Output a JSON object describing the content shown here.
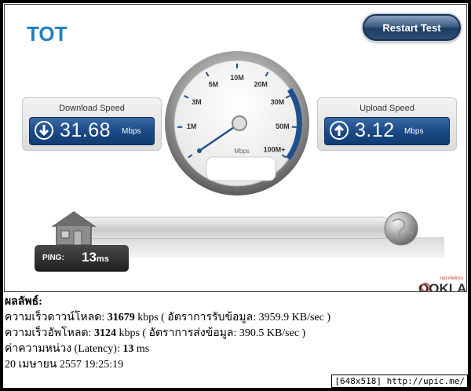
{
  "brand": {
    "logo_text": "TOT",
    "logo_color": "#1f7fc2"
  },
  "toolbar": {
    "restart_label": "Restart Test"
  },
  "download": {
    "title": "Download Speed",
    "value": "31.68",
    "unit": "Mbps"
  },
  "upload": {
    "title": "Upload Speed",
    "value": "3.12",
    "unit": "Mbps"
  },
  "gauge": {
    "tick_labels": [
      "0",
      "1M",
      "3M",
      "5M",
      "10M",
      "20M",
      "30M",
      "50M",
      "100M+"
    ],
    "unit": "Mbps",
    "needle_value": "0",
    "accent": "#1f4f8f"
  },
  "ping": {
    "label": "PING:",
    "value": "13",
    "unit": "ms"
  },
  "provider": {
    "powered_by": "net metrics",
    "name": "OOKLA"
  },
  "results": {
    "heading": "ผลลัพธ์:",
    "download_prefix": "ความเร็วดาวน์โหลด: ",
    "download_kbps": "31679",
    "download_suffix": " kbps ( อัตราการรับข้อมูล: 3959.9 KB/sec )",
    "upload_prefix": "ความเร็วอัพโหลด: ",
    "upload_kbps": "3124",
    "upload_suffix": " kbps ( อัตราการส่งข้อมูล: 390.5 KB/sec )",
    "latency_prefix": "ค่าความหน่วง (Latency): ",
    "latency_value": "13",
    "latency_suffix": " ms",
    "timestamp": "20 เมษายน 2557 19:25:19"
  },
  "watermark": {
    "text": "[648x518] http://upic.me/"
  }
}
